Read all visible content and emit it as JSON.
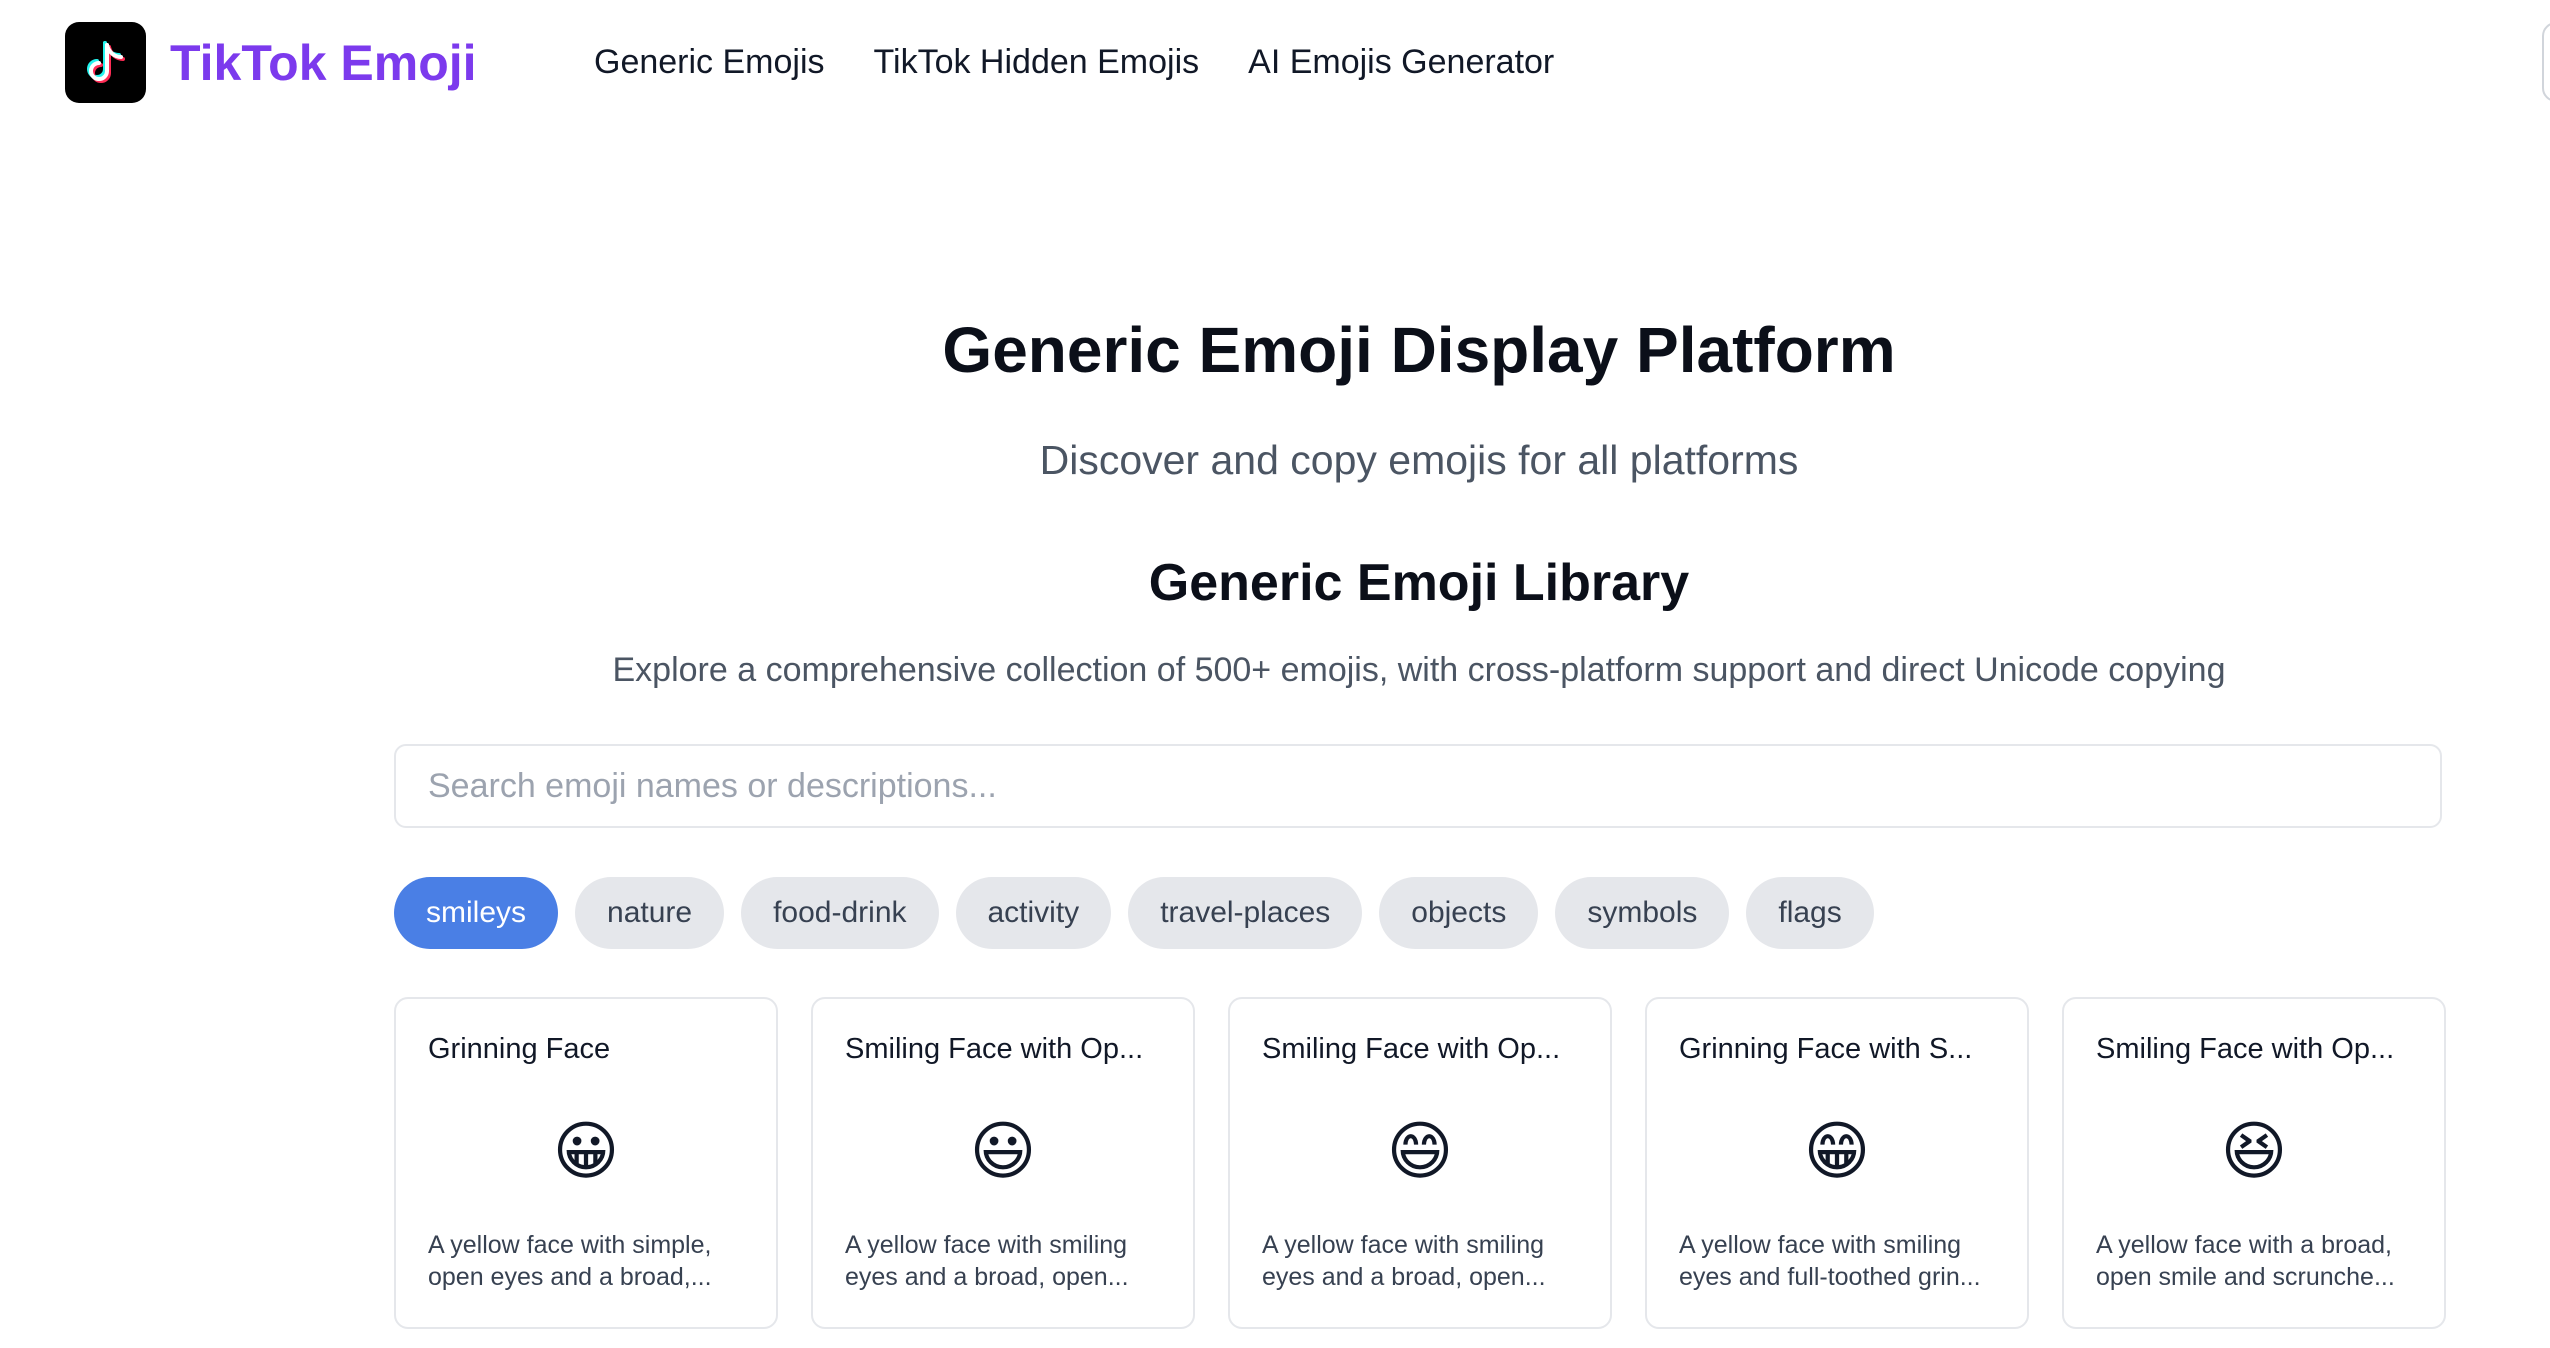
{
  "header": {
    "brand": "TikTok Emoji",
    "nav": [
      "Generic Emojis",
      "TikTok Hidden Emojis",
      "AI Emojis Generator"
    ]
  },
  "hero": {
    "title": "Generic Emoji Display Platform",
    "subtitle": "Discover and copy emojis for all platforms"
  },
  "library": {
    "title": "Generic Emoji Library",
    "description": "Explore a comprehensive collection of 500+ emojis, with cross-platform support and direct Unicode copying"
  },
  "search": {
    "placeholder": "Search emoji names or descriptions...",
    "value": ""
  },
  "categories": {
    "items": [
      "smileys",
      "nature",
      "food-drink",
      "activity",
      "travel-places",
      "objects",
      "symbols",
      "flags"
    ],
    "selected": "smileys"
  },
  "emojis": [
    {
      "title": "Grinning Face",
      "emoji": "😀",
      "description": "A yellow face with simple, open eyes and a broad,..."
    },
    {
      "title": "Smiling Face with Op...",
      "emoji": "😃",
      "description": "A yellow face with smiling eyes and a broad, open..."
    },
    {
      "title": "Smiling Face with Op...",
      "emoji": "😄",
      "description": "A yellow face with smiling eyes and a broad, open..."
    },
    {
      "title": "Grinning Face with S...",
      "emoji": "😁",
      "description": "A yellow face with smiling eyes and full-toothed grin..."
    },
    {
      "title": "Smiling Face with Op...",
      "emoji": "😆",
      "description": "A yellow face with a broad, open smile and scrunche..."
    }
  ],
  "colors": {
    "brand": "#7c3aed",
    "active_pill": "#4a7fe5",
    "pill": "#e5e7eb"
  },
  "icons": {
    "logo": "tiktok-note-icon"
  }
}
